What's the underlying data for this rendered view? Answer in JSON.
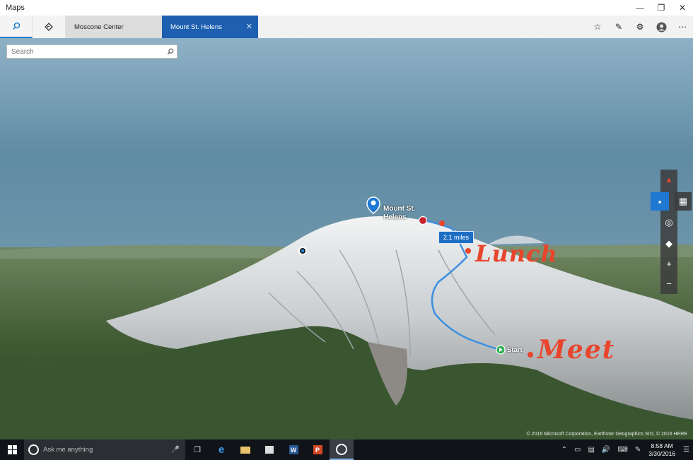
{
  "window": {
    "title": "Maps"
  },
  "tabs": [
    {
      "label": "Moscone Center",
      "active": false
    },
    {
      "label": "Mount St. Helens",
      "active": true
    }
  ],
  "search": {
    "placeholder": "Search"
  },
  "map": {
    "pin_label_line1": "Mount St.",
    "pin_label_line2": "Helens",
    "distance_label": "2.1 miles",
    "start_label": "Start",
    "ink_notes": [
      "Lunch",
      "Meet"
    ],
    "copyright": "© 2016 Microsoft Corporation, Earthstar Geographics SIO, © 2016 HERE",
    "route_color": "#3d8fe0",
    "ink_color": "#e8452c"
  },
  "taskbar": {
    "search_placeholder": "Ask me anything",
    "time": "8:58 AM",
    "date": "3/30/2016"
  },
  "accent_color": "#1e5fb0"
}
